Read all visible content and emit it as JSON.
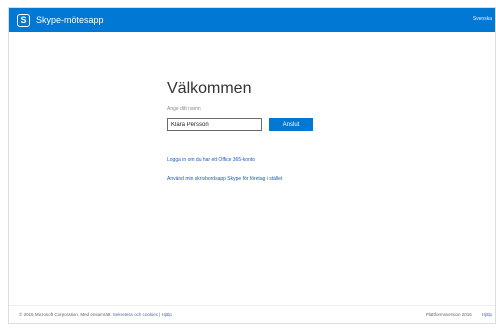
{
  "app": {
    "title": "Skype-mötesapp",
    "logo_letter": "S",
    "topbar_right": "Svenska"
  },
  "main": {
    "heading": "Välkommen",
    "name_label": "Ange ditt namn",
    "name_value": "Klara Persson",
    "join_label": "Anslut",
    "link_sign_in": "Logga in om du har ett Office 365-konto",
    "link_desktop": "Använd min skrivbordsapp Skype för företag i stället"
  },
  "footer": {
    "copyright": "© 2015 Microsoft Corporation. Med ensamrätt.",
    "privacy": "Sekretess och cookies",
    "separator": "|",
    "help": "Hjälp",
    "version": "Plattformsversion 2016",
    "right_link": "Hjälp"
  },
  "colors": {
    "accent": "#0078d4",
    "link": "#1a5fb4"
  }
}
